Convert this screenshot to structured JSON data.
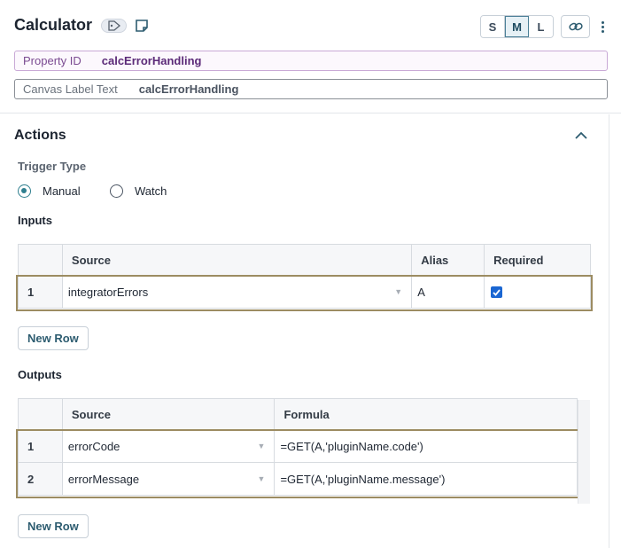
{
  "header": {
    "title": "Calculator",
    "size_options": [
      "S",
      "M",
      "L"
    ],
    "size_selected": "M",
    "property_id_label": "Property ID",
    "property_id_value": "calcErrorHandling",
    "canvas_label_label": "Canvas Label Text",
    "canvas_label_value": "calcErrorHandling"
  },
  "actions": {
    "title": "Actions",
    "trigger_type_label": "Trigger Type",
    "trigger_options": [
      {
        "label": "Manual",
        "checked": true
      },
      {
        "label": "Watch",
        "checked": false
      }
    ]
  },
  "inputs": {
    "title": "Inputs",
    "columns": [
      "Source",
      "Alias",
      "Required"
    ],
    "rows": [
      {
        "num": "1",
        "source": "integratorErrors",
        "alias": "A",
        "required": true
      }
    ],
    "new_row_label": "New Row"
  },
  "outputs": {
    "title": "Outputs",
    "columns": [
      "Source",
      "Formula"
    ],
    "rows": [
      {
        "num": "1",
        "source": "errorCode",
        "formula": "=GET(A,'pluginName.code')"
      },
      {
        "num": "2",
        "source": "errorMessage",
        "formula": "=GET(A,'pluginName.message')"
      }
    ],
    "new_row_label": "New Row"
  },
  "colors": {
    "accent": "#2f7f8f",
    "row_highlight": "#9c8c62",
    "checkbox": "#1a66d2"
  }
}
